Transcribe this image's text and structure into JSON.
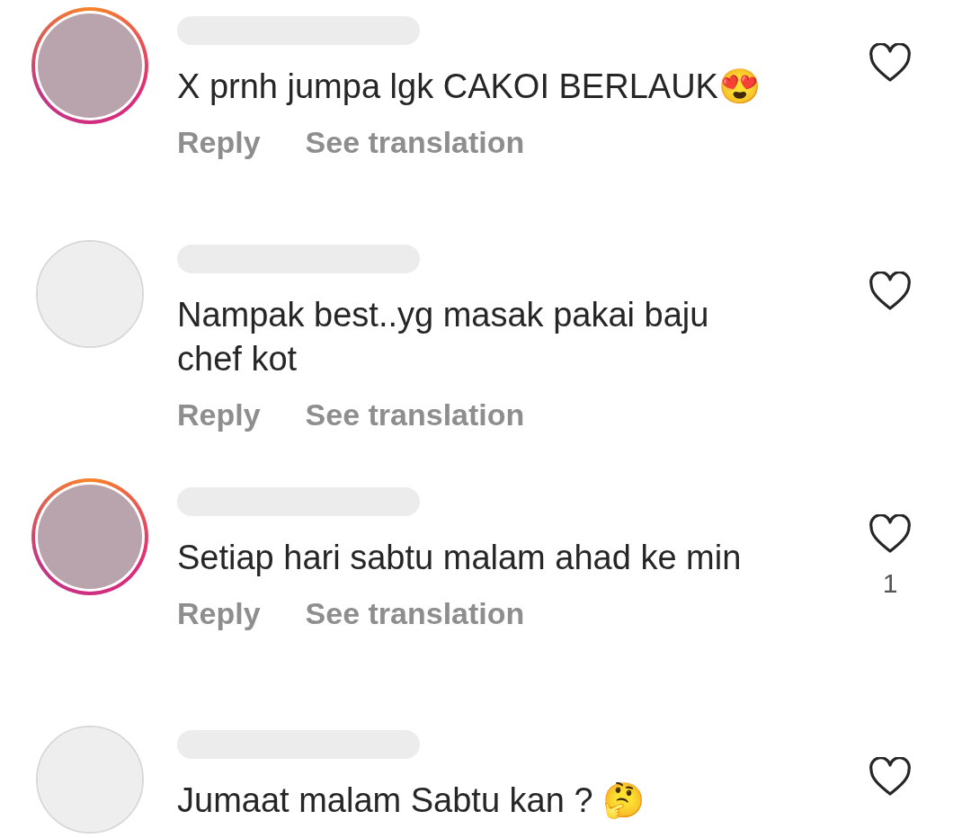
{
  "comments": [
    {
      "story_ring": true,
      "text": "X prnh jumpa lgk CAKOI BERLAUK😍",
      "actions": [
        "Reply",
        "See translation"
      ],
      "liked": false
    },
    {
      "story_ring": false,
      "text": "Nampak best..yg masak pakai baju chef kot",
      "actions": [
        "Reply",
        "See translation"
      ],
      "liked": false
    },
    {
      "story_ring": true,
      "text": "Setiap hari sabtu malam ahad ke min",
      "actions": [
        "Reply",
        "See translation"
      ],
      "liked": false,
      "like_count": "1"
    },
    {
      "story_ring": false,
      "text": "Jumaat malam Sabtu kan ? 🤔",
      "liked": false
    }
  ]
}
